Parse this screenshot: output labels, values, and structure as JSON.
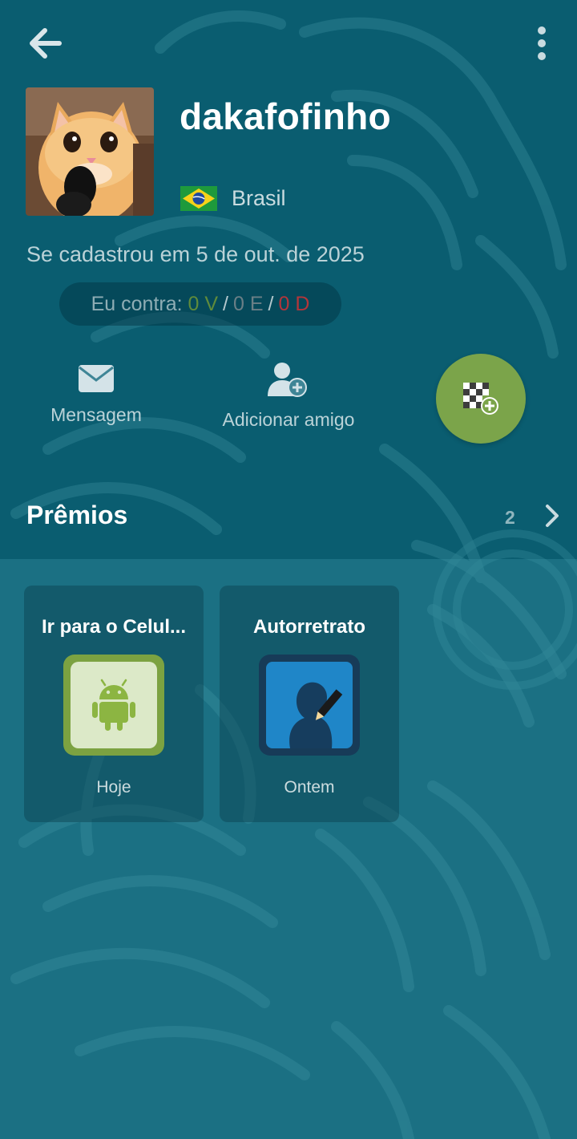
{
  "profile": {
    "username": "dakafofinho",
    "country": "Brasil",
    "joined": "Se cadastrou em 5 de out. de 2025"
  },
  "record": {
    "label": "Eu contra:",
    "wins": "0 V",
    "draws": "0 E",
    "losses": "0 D",
    "separator": "/"
  },
  "actions": {
    "message_label": "Mensagem",
    "add_friend_label": "Adicionar amigo"
  },
  "awards": {
    "title": "Prêmios",
    "count": "2",
    "items": [
      {
        "title": "Ir para o Celul...",
        "when": "Hoje",
        "icon": "android-icon"
      },
      {
        "title": "Autorretrato",
        "when": "Ontem",
        "icon": "selfie-icon"
      }
    ]
  },
  "colors": {
    "background": "#0a5d70",
    "accent_green": "#7ba44a",
    "win": "#5f8b3b",
    "draw": "#6a7f86",
    "loss": "#b3353a"
  }
}
